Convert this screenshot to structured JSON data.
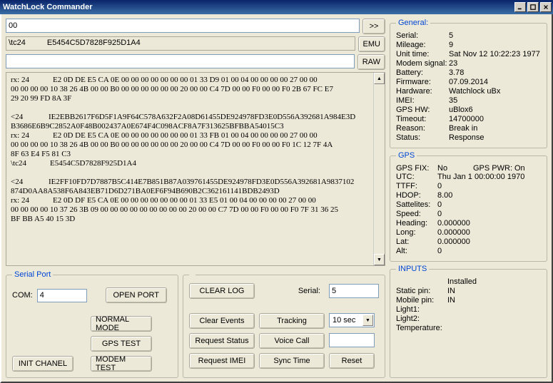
{
  "window": {
    "title": "WatchLock Commander"
  },
  "top": {
    "in1": "00",
    "in2_a": "\\tc24",
    "in2_b": "E5454C5D7828F925D1A4",
    "in3": "",
    "btn_go": ">>",
    "btn_emu": "EMU",
    "btn_raw": "RAW"
  },
  "log": "rx: 24            E2 0D DE E5 CA 0E 00 00 00 00 00 00 00 01 33 D9 01 00 04 00 00 00 00 27 00 00\n00 00 00 00 10 38 26 4B 00 00 B0 00 00 00 00 00 00 20 00 00 C4 7D 00 00 F0 00 00 F0 2B 67 FC E7\n29 20 99 FD 8A 3F\n\n<24             IE2EBB2617F6D5F1A9F64C578A632F2A08D61455DE924978FD3E0D556A392681A984E3D\nB3686E6B9C2852A0F48B002437A0E674F4C098ACF8A7F313625BFBBA54015C3\nrx: 24            E2 0D DE E5 CA 0E 00 00 00 00 00 00 00 01 33 FB 01 00 04 00 00 00 00 27 00 00\n00 00 00 00 10 38 26 4B 00 00 B0 00 00 00 00 00 00 20 00 00 C4 7D 00 00 F0 00 00 F0 1C 12 7F 4A\n8F 63 E4 F5 81 C3\n\\tc24            E5454C5D7828F925D1A4\n\n<24             IE2FF10FD7D7887B5C414E7B851B87A039761455DE924978FD3E0D556A392681A9837102\n874D0AA8A538F6A843EB71D6D271BA0EF6F94B690B2C362161141BDB2493D\nrx: 24            E2 0D DF E5 CA 0E 00 00 00 00 00 00 00 01 33 E5 01 00 04 00 00 00 00 27 00 00\n00 00 00 00 10 37 26 3B 09 00 00 00 00 00 00 00 00 00 20 00 00 C7 7D 00 00 F0 00 00 F0 7F 31 36 25\nBF BB A5 40 15 3D",
  "general": {
    "legend": "General:",
    "labels": {
      "serial": "Serial:",
      "mileage": "Mileage:",
      "unit_time": "Unit time:",
      "modem_signal": "Modem signal:",
      "battery": "Battery:",
      "firmware": "Firmware:",
      "hardware": "Hardware:",
      "imei": "IMEI:",
      "gps_hw": "GPS HW:",
      "timeout": "Timeout:",
      "reason": "Reason:",
      "status": "Status:"
    },
    "values": {
      "serial": "5",
      "mileage": "9",
      "unit_time": "Sat Nov 12 10:22:23 1977",
      "modem_signal": "23",
      "battery": "3.78",
      "firmware": "07.09.2014",
      "hardware": "Watchlock uBx",
      "imei": "35",
      "gps_hw": "uBlox6",
      "timeout": "14700000",
      "reason": "Break in",
      "status": "Response"
    }
  },
  "gps": {
    "legend": "GPS",
    "labels": {
      "fix": "GPS FIX:",
      "pwr": "GPS PWR:",
      "utc": "UTC:",
      "ttff": "TTFF:",
      "hdop": "HDOP:",
      "sat": "Sattelites:",
      "speed": "Speed:",
      "heading": "Heading:",
      "long": "Long:",
      "lat": "Lat:",
      "alt": "Alt:"
    },
    "values": {
      "fix": "No",
      "pwr": "On",
      "utc": "Thu Jan  1 00:00:00 1970",
      "ttff": "0",
      "hdop": "8.00",
      "sat": "0",
      "speed": "0",
      "heading": "0.000000",
      "long": "0.000000",
      "lat": "0.000000",
      "alt": "0"
    }
  },
  "inputs": {
    "legend": "INPUTS",
    "labels": {
      "installed": "",
      "static": "Static pin:",
      "mobile": "Mobile pin:",
      "light1": "Light1:",
      "light2": "Light2:",
      "temp": "Temperature:"
    },
    "values": {
      "installed": "Installed",
      "static": "IN",
      "mobile": "IN",
      "light1": "",
      "light2": "",
      "temp": ""
    }
  },
  "serial_port": {
    "legend": "Serial Port",
    "com_label": "COM:",
    "com_value": "4",
    "open_port": "OPEN PORT",
    "normal_mode": "NORMAL MODE",
    "gps_test": "GPS TEST",
    "modem_test": "MODEM TEST",
    "init_chanel": "INIT CHANEL"
  },
  "ctrl": {
    "clear_log": "CLEAR LOG",
    "serial_label": "Serial:",
    "serial_value": "5",
    "clear_events": "Clear Events",
    "tracking": "Tracking",
    "track_interval": "10 sec",
    "request_status": "Request Status",
    "voice_call": "Voice Call",
    "voice_value": "",
    "request_imei": "Request IMEI",
    "sync_time": "Sync Time",
    "reset": "Reset"
  }
}
